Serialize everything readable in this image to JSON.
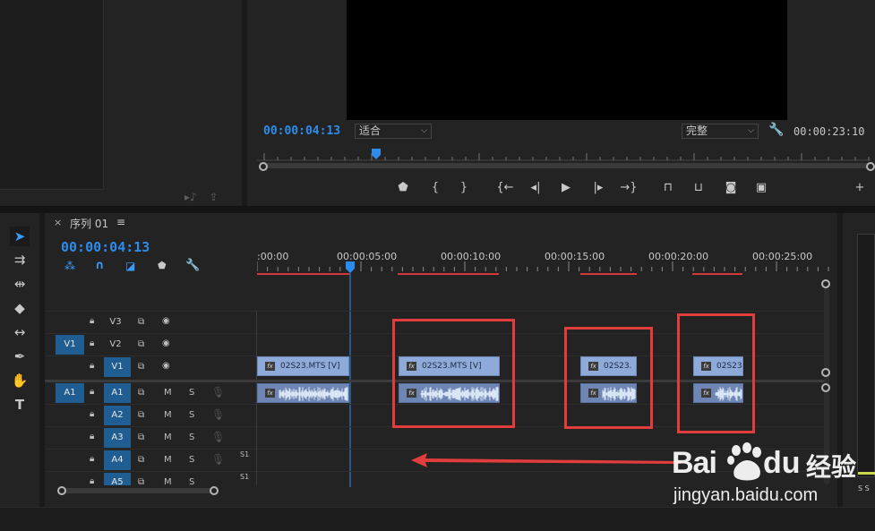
{
  "program_monitor": {
    "current_timecode": "00:00:04:13",
    "fit_select": "适合",
    "quality_select": "完整",
    "duration_timecode": "00:00:23:10"
  },
  "timeline": {
    "sequence_name": "序列 01",
    "current_timecode": "00:00:04:13",
    "ruler_labels": [
      ":00:00",
      "00:00:05:00",
      "00:00:10:00",
      "00:00:15:00",
      "00:00:20:00",
      "00:00:25:00"
    ],
    "video_tracks": [
      {
        "name": "V3",
        "targeted": false,
        "source": ""
      },
      {
        "name": "V2",
        "targeted": false,
        "source": "V1"
      },
      {
        "name": "V1",
        "targeted": true,
        "source": ""
      }
    ],
    "audio_tracks": [
      {
        "name": "A1",
        "source": "A1",
        "m": "M",
        "s": "S"
      },
      {
        "name": "A2",
        "m": "M",
        "s": "S"
      },
      {
        "name": "A3",
        "m": "M",
        "s": "S"
      },
      {
        "name": "A4",
        "m": "M",
        "s": "S"
      },
      {
        "name": "A5",
        "m": "M",
        "s": "S"
      }
    ],
    "video_clips": [
      {
        "label": "02S23.MTS [V]"
      },
      {
        "label": "02S23.MTS [V]"
      },
      {
        "label": "02S23."
      },
      {
        "label": "02S23"
      }
    ],
    "audio_level_label": "S1"
  },
  "meter": {
    "labels": "S S"
  },
  "watermark": {
    "brand_a": "Bai",
    "brand_b": "du",
    "brand_cn": "经验",
    "url": "jingyan.baidu.com"
  },
  "colors": {
    "accent_blue": "#2d8ceb",
    "target_blue": "#1f5d93",
    "clip_video": "#8daad8",
    "clip_audio": "#6f86b4",
    "annotation_red": "#e23d3d"
  }
}
